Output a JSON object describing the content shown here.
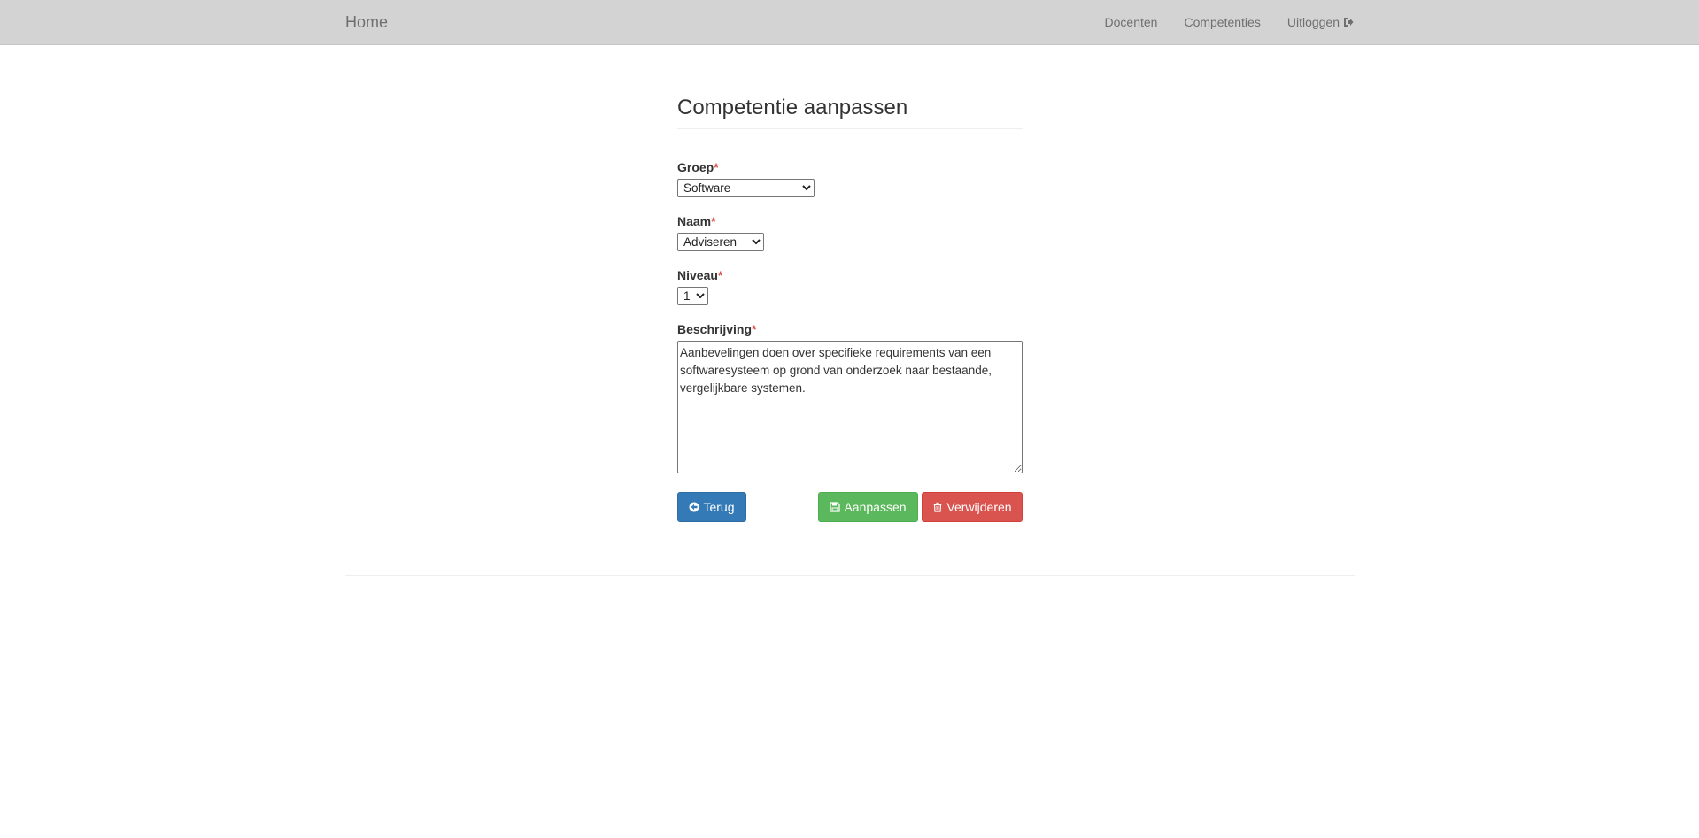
{
  "navbar": {
    "brand": "Home",
    "links": {
      "docenten": "Docenten",
      "competenties": "Competenties",
      "uitloggen": "Uitloggen"
    },
    "logout_icon": "sign-out-icon"
  },
  "form": {
    "title": "Competentie aanpassen",
    "required_mark": "*",
    "groep": {
      "label": "Groep",
      "selected": "Software"
    },
    "naam": {
      "label": "Naam",
      "selected": "Adviseren"
    },
    "niveau": {
      "label": "Niveau",
      "selected": "1"
    },
    "beschrijving": {
      "label": "Beschrijving",
      "value": "Aanbevelingen doen over specifieke requirements van een softwaresysteem op grond van onderzoek naar bestaande, vergelijkbare systemen."
    }
  },
  "buttons": {
    "back": {
      "label": "Terug",
      "icon": "arrow-circle-left-icon",
      "color": "#337ab7"
    },
    "save": {
      "label": "Aanpassen",
      "icon": "floppy-disk-icon",
      "color": "#5cb85c"
    },
    "delete": {
      "label": "Verwijderen",
      "icon": "trash-icon",
      "color": "#d9534f"
    }
  }
}
